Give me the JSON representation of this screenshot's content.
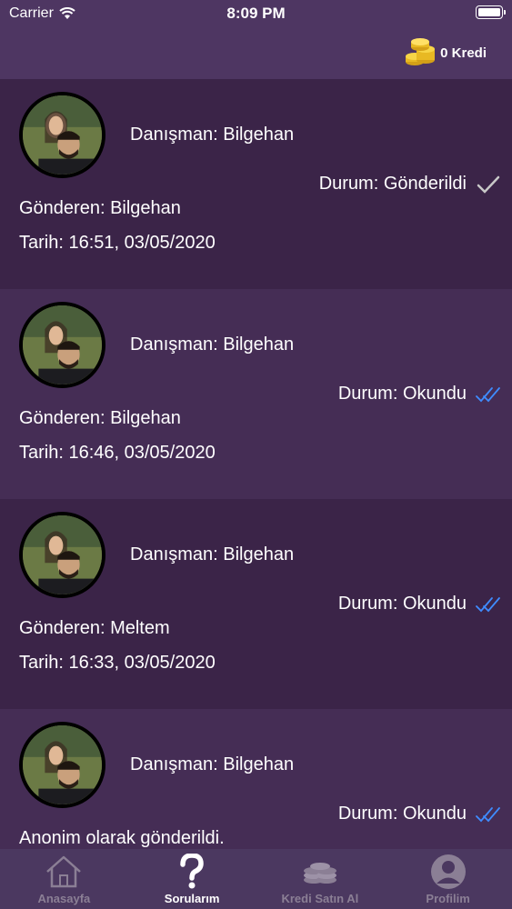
{
  "status_bar": {
    "carrier": "Carrier",
    "time": "8:09 PM"
  },
  "header": {
    "credits": "0 Kredi"
  },
  "questions": [
    {
      "advisor": "Danışman: Bilgehan",
      "status": "Durum: Gönderildi",
      "status_icon": "single-check-icon",
      "sender": "Gönderen: Bilgehan",
      "date": "Tarih: 16:51, 03/05/2020"
    },
    {
      "advisor": "Danışman: Bilgehan",
      "status": "Durum: Okundu",
      "status_icon": "double-check-icon",
      "sender": "Gönderen: Bilgehan",
      "date": "Tarih: 16:46, 03/05/2020"
    },
    {
      "advisor": "Danışman: Bilgehan",
      "status": "Durum: Okundu",
      "status_icon": "double-check-icon",
      "sender": "Gönderen: Meltem",
      "date": "Tarih: 16:33, 03/05/2020"
    },
    {
      "advisor": "Danışman: Bilgehan",
      "status": "Durum: Okundu",
      "status_icon": "double-check-icon",
      "sender": "Anonim olarak gönderildi."
    }
  ],
  "tabs": [
    {
      "label": "Anasayfa",
      "icon": "home-icon",
      "active": false
    },
    {
      "label": "Sorularım",
      "icon": "question-icon",
      "active": true
    },
    {
      "label": "Kredi Satın Al",
      "icon": "coins-icon",
      "active": false
    },
    {
      "label": "Profilim",
      "icon": "profile-icon",
      "active": false
    }
  ],
  "colors": {
    "read_check": "#3f8cff",
    "sent_check": "#c8c8c8",
    "tab_inactive": "#8b7f95"
  }
}
